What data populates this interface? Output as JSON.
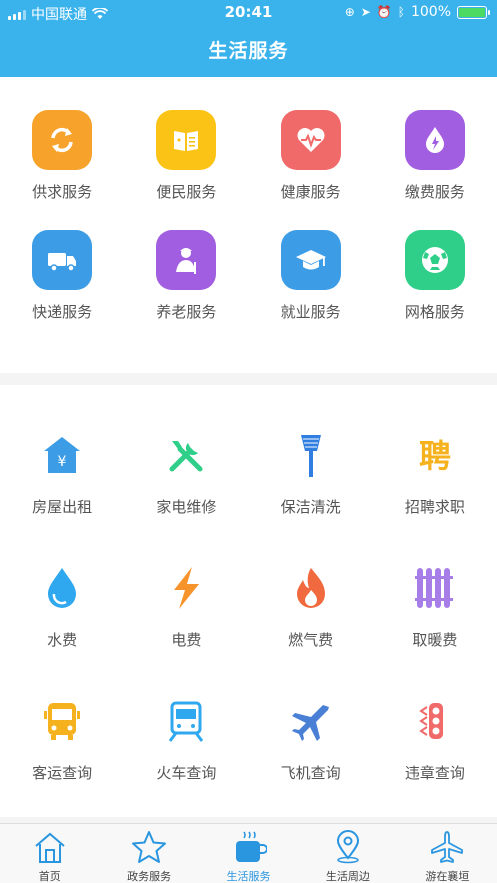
{
  "status": {
    "carrier": "中国联通",
    "time": "20:41",
    "battery": "100%"
  },
  "header": {
    "title": "生活服务"
  },
  "top_services": [
    {
      "label": "供求服务",
      "icon": "exchange-icon",
      "color": "#f7a22b"
    },
    {
      "label": "便民服务",
      "icon": "book-icon",
      "color": "#fbc316"
    },
    {
      "label": "健康服务",
      "icon": "heart-icon",
      "color": "#f16a6a"
    },
    {
      "label": "缴费服务",
      "icon": "droplet-icon",
      "color": "#a15ee0"
    },
    {
      "label": "快递服务",
      "icon": "truck-icon",
      "color": "#3c9de6"
    },
    {
      "label": "养老服务",
      "icon": "elder-icon",
      "color": "#a15ee0"
    },
    {
      "label": "就业服务",
      "icon": "graduation-cap-icon",
      "color": "#3c9de6"
    },
    {
      "label": "网格服务",
      "icon": "soccer-ball-icon",
      "color": "#2fcf8a"
    }
  ],
  "bottom_services": [
    {
      "label": "房屋出租",
      "icon": "house-icon",
      "color": "#3c9de6"
    },
    {
      "label": "家电维修",
      "icon": "tools-icon",
      "color": "#2fcf8a"
    },
    {
      "label": "保洁清洗",
      "icon": "broom-icon",
      "color": "#2f7ee0"
    },
    {
      "label": "招聘求职",
      "icon": "recruit-icon",
      "color": "#f6b21e",
      "glyph": "聘"
    },
    {
      "label": "水费",
      "icon": "water-drop-icon",
      "color": "#2fa8ef"
    },
    {
      "label": "电费",
      "icon": "lightning-icon",
      "color": "#f7932b"
    },
    {
      "label": "燃气费",
      "icon": "flame-icon",
      "color": "#f16a3f"
    },
    {
      "label": "取暖费",
      "icon": "radiator-icon",
      "color": "#a77ee8"
    },
    {
      "label": "客运查询",
      "icon": "bus-icon",
      "color": "#f6b21e"
    },
    {
      "label": "火车查询",
      "icon": "train-icon",
      "color": "#2fa8ef"
    },
    {
      "label": "飞机查询",
      "icon": "airplane-icon",
      "color": "#4a7fd6"
    },
    {
      "label": "违章查询",
      "icon": "traffic-light-icon",
      "color": "#f16a6a"
    }
  ],
  "tabs": [
    {
      "label": "首页",
      "icon": "home-icon",
      "active": false
    },
    {
      "label": "政务服务",
      "icon": "star-icon",
      "active": false
    },
    {
      "label": "生活服务",
      "icon": "coffee-cup-icon",
      "active": true
    },
    {
      "label": "生活周边",
      "icon": "location-pin-icon",
      "active": false
    },
    {
      "label": "游在襄垣",
      "icon": "airplane-icon",
      "active": false
    }
  ],
  "colors": {
    "header_bg": "#3ab3ec",
    "active_tab": "#2b96e0",
    "inactive_tab": "#444444"
  }
}
